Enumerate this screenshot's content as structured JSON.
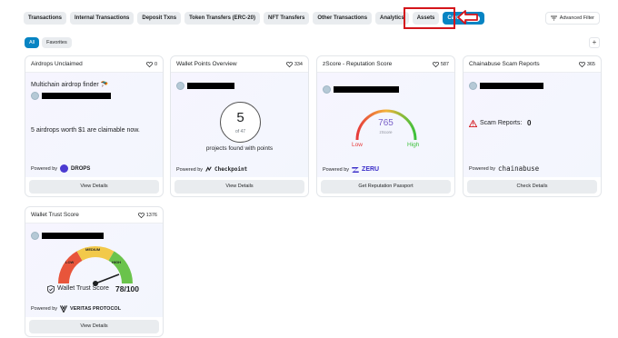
{
  "tabs": [
    {
      "label": "Transactions"
    },
    {
      "label": "Internal Transactions"
    },
    {
      "label": "Deposit Txns"
    },
    {
      "label": "Token Transfers (ERC-20)"
    },
    {
      "label": "NFT Transfers"
    },
    {
      "label": "Other Transactions"
    },
    {
      "label": "Analytics"
    },
    {
      "label": "Assets"
    },
    {
      "label": "Cards",
      "badge": "New"
    }
  ],
  "advanced_filter": "Advanced Filter",
  "subtabs": [
    "All",
    "Favorites"
  ],
  "plus": "+",
  "powered_by": "Powered by",
  "cards": {
    "airdrops": {
      "title": "Airdrops Unclaimed",
      "likes": "0",
      "heading": "Multichain airdrop finder 🪂",
      "summary": "5 airdrops worth $1 are claimable now.",
      "brand": "DROPS",
      "button": "View Details"
    },
    "wallet_points": {
      "title": "Wallet Points Overview",
      "likes": "334",
      "count": "5",
      "of_total": "of 47",
      "caption": "projects found with points",
      "brand": "Checkpoint",
      "button": "View Details"
    },
    "zscore": {
      "title": "zScore - Reputation Score",
      "likes": "587",
      "score": "765",
      "score_label": "zScore",
      "low": "Low",
      "high": "High",
      "brand": "ZERU",
      "button": "Get Reputation Passport"
    },
    "chainabuse": {
      "title": "Chainabuse Scam Reports",
      "likes": "365",
      "reports_label": "Scam Reports:",
      "reports_value": "0",
      "brand": "chainabuse",
      "button": "Check Details"
    },
    "wallet_trust": {
      "title": "Wallet Trust Score",
      "likes": "1376",
      "gauge_labels": {
        "low": "LOW",
        "medium": "MEDIUM",
        "high": "HIGH"
      },
      "label": "Wallet Trust Score",
      "value": "78/100",
      "brand": "VERITAS PROTOCOL",
      "button": "View Details"
    }
  },
  "colors": {
    "accent": "#0784c3",
    "highlight": "#d4151b",
    "gauge_low": "#e63b3b",
    "gauge_high": "#3cc13b",
    "score": "#7a62c9"
  }
}
